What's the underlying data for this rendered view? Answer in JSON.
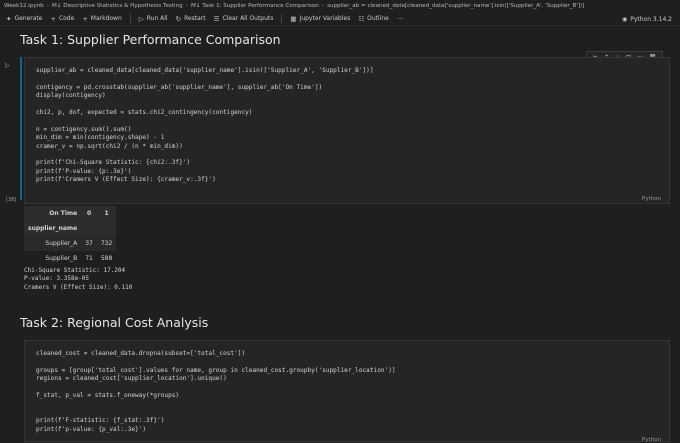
{
  "breadcrumb": [
    "Week12.ipynb",
    "M↓ Descriptive Statistics & Hypothesis Testing",
    "M↓ Task 1: Supplier Performance Comparison",
    "supplier_ab = cleaned_data[cleaned_data['supplier_name'].isin(['Supplier_A', 'Supplier_B'])]"
  ],
  "toolbar": {
    "generate": "Generate",
    "code": "Code",
    "markdown": "Markdown",
    "run_all": "Run All",
    "restart": "Restart",
    "clear": "Clear All Outputs",
    "variables": "Jupyter Variables",
    "outline": "Outline",
    "kernel": "Python 3.14.2"
  },
  "task1": {
    "heading": "Task 1: Supplier Performance Comparison",
    "exec_count": "[38]",
    "lang": "Python",
    "code_lines": [
      "supplier_ab = cleaned_data[cleaned_data['supplier_name'].isin(['Supplier_A', 'Supplier_B'])]",
      "",
      "contigency = pd.crosstab(supplier_ab['supplier_name'], supplier_ab['On Time'])",
      "display(contigency)",
      "",
      "chi2, p, dof, expected = stats.chi2_contingency(contigency)",
      "",
      "n = contigency.sum().sum()",
      "min_dim = min(contigency.shape) - 1",
      "cramer_v = np.sqrt(chi2 / (n * min_dim))",
      "",
      "print(f'Chi-Square Statistic: {chi2:.3f}')",
      "print(f'P-value: {p:.3e}')",
      "print(f'Cramers V (Effect Size): {cramer_v:.3f}')"
    ],
    "table": {
      "col_header": "On Time",
      "cols": [
        "0",
        "1"
      ],
      "index_name": "supplier_name",
      "rows": [
        {
          "name": "Supplier_A",
          "v0": "37",
          "v1": "732"
        },
        {
          "name": "Supplier_B",
          "v0": "71",
          "v1": "588"
        }
      ]
    },
    "output_lines": [
      "Chi-Square Statistic: 17.204",
      "P-value: 3.358e-05",
      "Cramers V (Effect Size): 0.110"
    ]
  },
  "task2": {
    "heading": "Task 2: Regional Cost Analysis",
    "lang": "Python",
    "code_lines": [
      "cleaned_cost = cleaned_data.dropna(subset=['total_cost'])",
      "",
      "groups = [group['total_cost'].values for name, group in cleaned_cost.groupby('supplier_location')]",
      "regions = cleaned_cost['supplier_location'].unique()",
      "",
      "f_stat, p_val = stats.f_oneway(*groups)",
      "",
      "",
      "print(f'F-statistic: {f_stat:.3f}')",
      "print(f'p-value: {p_val:.3e}')"
    ]
  }
}
